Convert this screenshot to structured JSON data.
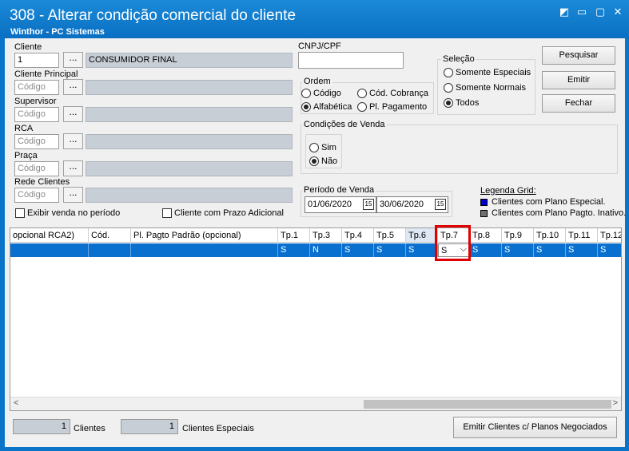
{
  "window": {
    "title": "308 - Alterar condição comercial do cliente",
    "subtitle": "Winthor - PC Sistemas",
    "controls": {
      "restore": "◩",
      "minimize": "▭",
      "maximize": "▢",
      "close": "✕"
    }
  },
  "form": {
    "dots": "...",
    "cliente": {
      "label": "Cliente",
      "value": "1",
      "name": "CONSUMIDOR FINAL"
    },
    "cliente_principal": {
      "label": "Cliente Principal",
      "placeholder": "Código"
    },
    "supervisor": {
      "label": "Supervisor",
      "placeholder": "Código"
    },
    "rca": {
      "label": "RCA",
      "placeholder": "Código"
    },
    "praca": {
      "label": "Praça",
      "placeholder": "Código"
    },
    "rede": {
      "label": "Rede Clientes",
      "placeholder": "Código"
    },
    "exibir_venda": "Exibir venda no período",
    "prazo_adicional": "Cliente com Prazo Adicional",
    "cnpj_label": "CNPJ/CPF",
    "ordem": {
      "title": "Ordem",
      "codigo": "Código",
      "cod_cobranca": "Cód. Cobrança",
      "alfabetica": "Alfabética",
      "pl_pagamento": "Pl. Pagamento"
    },
    "selecao": {
      "title": "Seleção",
      "especiais": "Somente Especiais",
      "normais": "Somente Normais",
      "todos": "Todos"
    },
    "condicoes": {
      "title": "Condições de Venda",
      "sim": "Sim",
      "nao": "Não"
    },
    "periodo": {
      "title": "Período de Venda",
      "start": "01/06/2020",
      "end": "30/06/2020",
      "cal": "15"
    },
    "legenda": {
      "title": "Legenda Grid:",
      "especial": "Clientes com Plano Especial.",
      "inativo": "Clientes com Plano Pagto. Inativo.",
      "color_especial": "#0000cc",
      "color_inativo": "#707070"
    }
  },
  "buttons": {
    "pesquisar": "Pesquisar",
    "emitir": "Emitir",
    "fechar": "Fechar",
    "emitir_planos": "Emitir Clientes c/ Planos Negociados"
  },
  "grid": {
    "headers": [
      "opcional RCA2)",
      "Cód.",
      "Pl. Pagto Padrão (opcional)",
      "Tp.1",
      "Tp.3",
      "Tp.4",
      "Tp.5",
      "Tp.6",
      "Tp.7",
      "Tp.8",
      "Tp.9",
      "Tp.10",
      "Tp.11",
      "Tp.12"
    ],
    "row": [
      "",
      "",
      "",
      "S",
      "N",
      "S",
      "S",
      "S",
      "S",
      "S",
      "S",
      "S",
      "S",
      "S"
    ],
    "scroll_left": "<",
    "scroll_right": ">"
  },
  "footer": {
    "clientes_count": "1",
    "clientes_label": "Clientes",
    "especiais_count": "1",
    "especiais_label": "Clientes Especiais"
  }
}
